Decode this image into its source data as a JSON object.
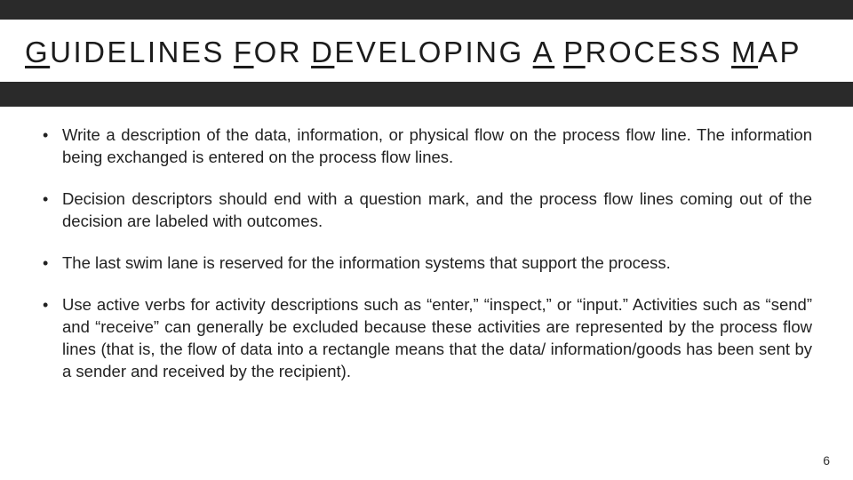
{
  "title_words": [
    "GUIDELINES",
    "FOR",
    "DEVELOPING",
    "A",
    "PROCESS",
    "MAP"
  ],
  "bullets": [
    "Write a description of the data, information, or physical flow on the process flow line. The information being exchanged is entered on the process flow lines.",
    "Decision descriptors should end with a question mark, and the process flow lines coming out of the decision are labeled with outcomes.",
    "The last swim lane is reserved for the information systems that support the process.",
    "Use active verbs for activity descriptions such as “enter,” “inspect,” or “input.” Activities such as “send” and “receive” can generally be excluded because these activities are represented by the process flow lines (that is, the flow of data into a rectangle means that the data/ information/goods has been sent by a sender and received by the recipient)."
  ],
  "page_number": "6"
}
